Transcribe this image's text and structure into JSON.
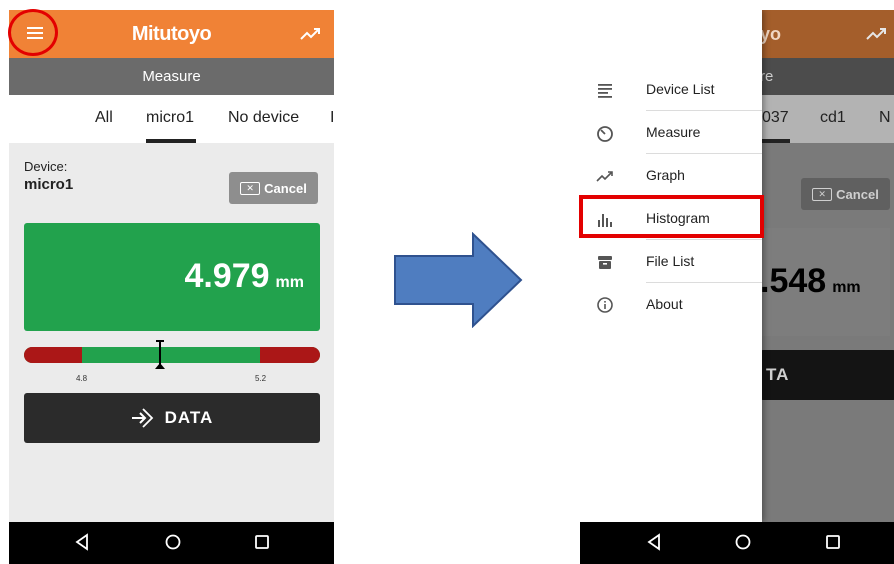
{
  "left_screen": {
    "brand": "Mitutoyo",
    "subtitle": "Measure",
    "tabs": [
      "All",
      "micro1",
      "No device",
      "I"
    ],
    "device_label": "Device:",
    "device_name": "micro1",
    "cancel_label": "Cancel",
    "measurement_value": "4.979",
    "measurement_unit": "mm",
    "tolerance_low": "4.8",
    "tolerance_high": "5.2",
    "data_button_label": "DATA",
    "colors": {
      "appbar": "#f08236",
      "ok": "#22a24d",
      "ng": "#ab1717"
    }
  },
  "right_screen": {
    "brand_partial": "yo",
    "subtitle_partial": "re",
    "tabs_partial": [
      "037",
      "cd1",
      "N"
    ],
    "cancel_label": "Cancel",
    "measurement_value_partial": ".548",
    "measurement_unit": "mm",
    "data_button_partial": "TA",
    "drawer_items": [
      {
        "label": "Device List",
        "icon": "list-icon"
      },
      {
        "label": "Measure",
        "icon": "gauge-icon"
      },
      {
        "label": "Graph",
        "icon": "trend-icon"
      },
      {
        "label": "Histogram",
        "icon": "histogram-icon"
      },
      {
        "label": "File List",
        "icon": "archive-icon"
      },
      {
        "label": "About",
        "icon": "info-icon"
      }
    ],
    "highlighted_item": "Histogram"
  },
  "annotation": {
    "arrow_color": "#4f7dc0",
    "highlight_color": "#e30000"
  }
}
